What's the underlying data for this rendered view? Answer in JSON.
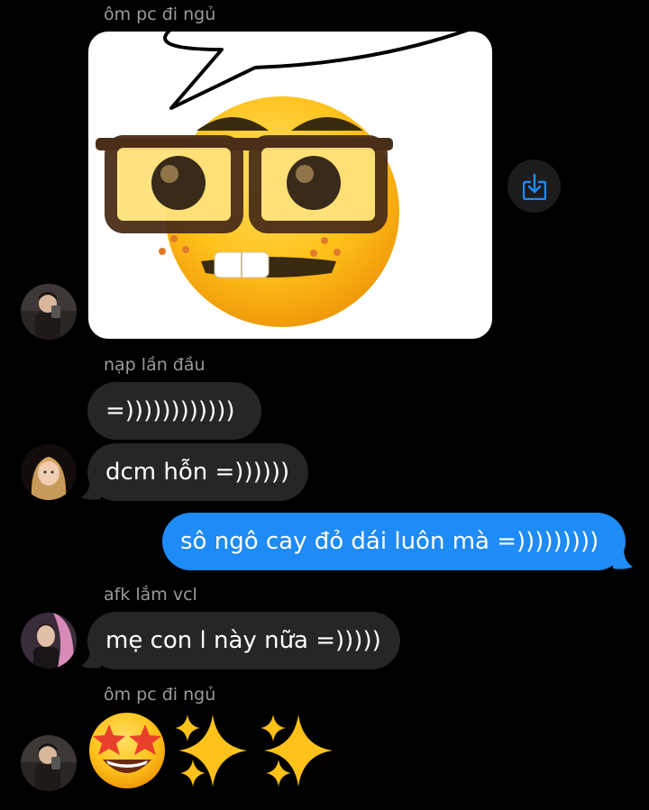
{
  "messages": {
    "m1_sender": "ôm pc đi ngủ",
    "m2_sender": "nạp lần đầu",
    "m2_text1": "=))))))))))))",
    "m2_text2": "dcm hỗn =))))))",
    "m3_text": "sô ngô cay đỏ dái luôn mà =)))))))))",
    "m4_sender": "afk lắm vcl",
    "m4_text": "mẹ con l này nữa =)))))",
    "m5_sender": "ôm pc đi ngủ"
  },
  "icons": {
    "share": "share-icon",
    "nerd_emoji": "nerd-face-image",
    "star_struck": "star-struck-emoji",
    "sparkles": "sparkles-emoji"
  },
  "colors": {
    "incoming_bubble": "#262628",
    "outgoing_bubble": "#1e8bf7",
    "sender_name": "#9a9a9f",
    "share_icon": "#1e8bf7"
  }
}
